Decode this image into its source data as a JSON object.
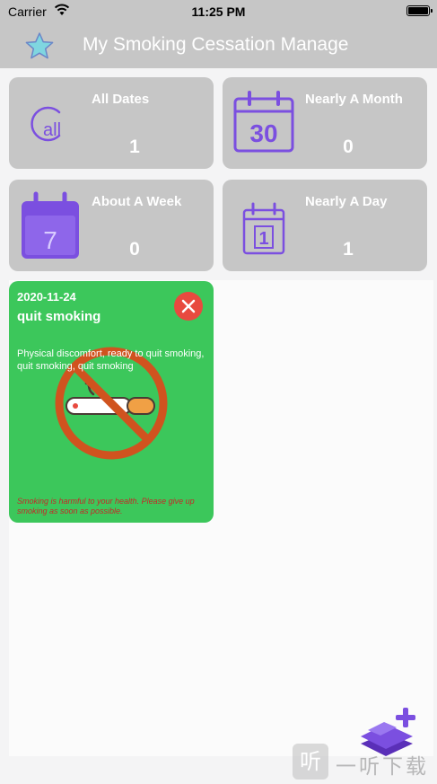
{
  "status_bar": {
    "carrier": "Carrier",
    "time": "11:25 PM",
    "battery_level": 1.0
  },
  "nav": {
    "title": "My Smoking Cessation Manage",
    "star_icon": "star-icon",
    "accent": "#7fd6e0"
  },
  "stats": [
    {
      "label": "All Dates",
      "value": "1",
      "icon": "all-icon",
      "icon_text": "all"
    },
    {
      "label": "Nearly A Month",
      "value": "0",
      "icon": "calendar-30-icon",
      "icon_text": "30"
    },
    {
      "label": "About A Week",
      "value": "0",
      "icon": "calendar-7-icon",
      "icon_text": "7"
    },
    {
      "label": "Nearly A Day",
      "value": "1",
      "icon": "calendar-1-icon",
      "icon_text": "1"
    }
  ],
  "colors": {
    "card_bg": "#c6c6c6",
    "icon_purple": "#7b4fe0",
    "record_green": "#3cc75b",
    "close_red": "#e84a3f",
    "warning_red": "#c62828"
  },
  "record": {
    "date": "2020-11-24",
    "title": "quit smoking",
    "description": "Physical discomfort, ready to quit smoking, quit smoking, quit smoking",
    "warning": "Smoking is harmful to your health. Please give up smoking as soon as possible.",
    "illustration_icon": "no-smoking-icon",
    "close_icon": "close-icon"
  },
  "add_button": {
    "icon": "add-layers-icon"
  },
  "watermark": {
    "logo_char": "听",
    "text": "一听下载"
  }
}
